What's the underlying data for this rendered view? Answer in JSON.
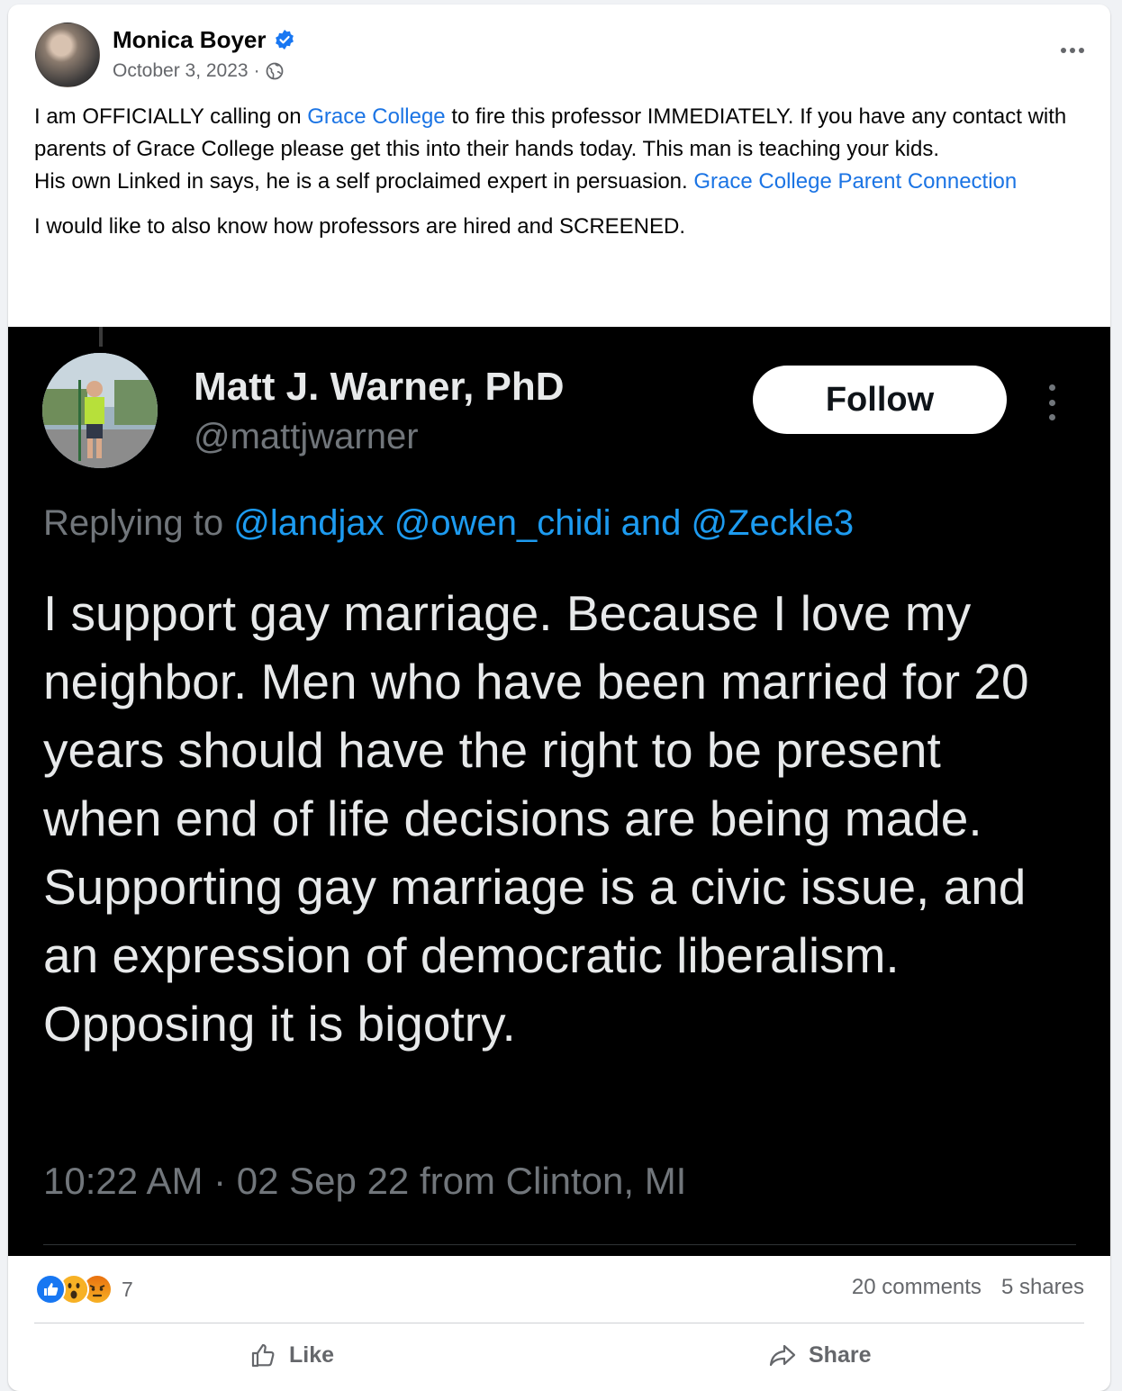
{
  "post": {
    "author": "Monica Boyer",
    "date": "October 3, 2023",
    "meta_separator": " ·",
    "text": {
      "p1_a": "I am OFFICIALLY calling on ",
      "p1_link": "Grace College",
      "p1_b": " to fire this professor IMMEDIATELY.   If you have any contact with parents of Grace College please get this into their hands today. This man is teaching your kids.",
      "p2_a": "His own Linked in says, he is a self proclaimed expert in persuasion. ",
      "p2_link": "Grace College Parent Connection",
      "p3": "I would like to also know how professors are hired and SCREENED."
    }
  },
  "tweet": {
    "name": "Matt J. Warner, PhD",
    "handle": "@mattjwarner",
    "follow_label": "Follow",
    "replying_prefix": "Replying to ",
    "mention_1": "@landjax",
    "mention_2": "@owen_chidi",
    "and_word": " and ",
    "mention_3": "@Zeckle3",
    "body": "I support gay marriage. Because I love my neighbor. Men who have been married for 20 years should have the right to be present when end of life decisions are being made. Supporting gay marriage is a civic issue, and an expression of democratic liberalism. Opposing it is bigotry.",
    "timestamp": "10:22 AM · 02 Sep 22 from Clinton, MI"
  },
  "footer": {
    "reaction_count": "7",
    "comments": "20 comments",
    "shares": "5 shares",
    "like_label": "Like",
    "share_label": "Share"
  },
  "colors": {
    "link": "#1b74e4",
    "mention": "#1d9bf0",
    "verified": "#1877f2",
    "tweet_bg": "#000000"
  }
}
